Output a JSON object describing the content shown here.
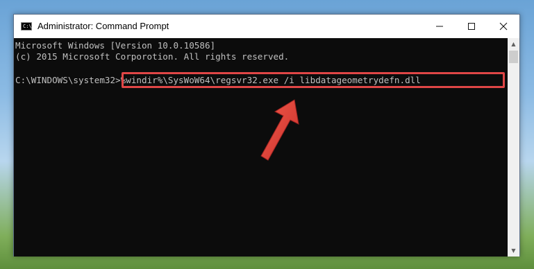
{
  "window": {
    "title": "Administrator: Command Prompt",
    "icon_text": "C:\\",
    "controls": {
      "minimize": "minimize-icon",
      "maximize": "maximize-icon",
      "close": "close-icon"
    }
  },
  "console": {
    "lines": [
      "Microsoft Windows [Version 10.0.10586]",
      "(c) 2015 Microsoft Corporotion. All rights reserved."
    ],
    "prompt": "C:\\WINDOWS\\system32>",
    "command": "%windir%\\SysWoW64\\regsvr32.exe /i libdatageometrydefn.dll"
  },
  "colors": {
    "console_bg": "#0c0c0c",
    "console_text": "#c0c0c0",
    "highlight": "#e04646"
  },
  "icons": [
    "app-cmd-icon",
    "minimize-icon",
    "maximize-icon",
    "close-icon",
    "red-arrow-icon",
    "scroll-up-icon",
    "scroll-down-icon"
  ]
}
